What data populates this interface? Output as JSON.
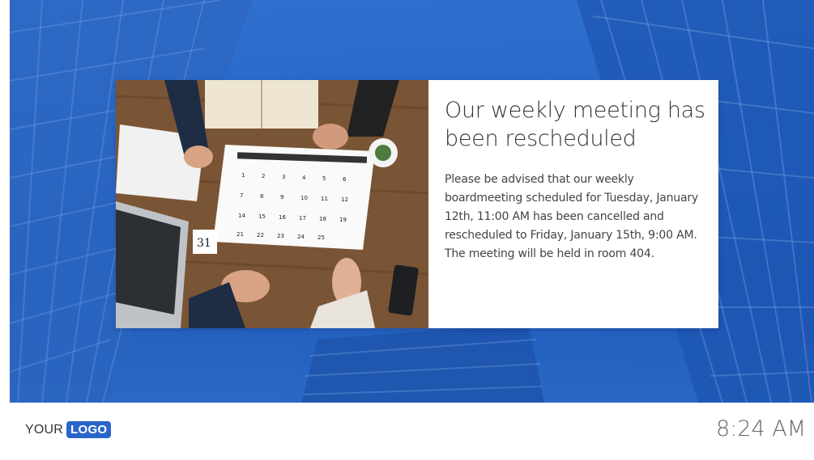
{
  "announcement": {
    "headline": "Our weekly meeting has been rescheduled",
    "body": "Please be advised that our weekly boardmeeting scheduled for Tuesday, January 12th, 11:00 AM has been cancelled and rescheduled to Friday, January 15th, 9:00 AM. The meeting will be held in room 404.",
    "image_icon": "calendar-meeting-photo"
  },
  "footer": {
    "logo_prefix": "YOUR",
    "logo_badge": "LOGO",
    "time": "8:24 AM"
  },
  "colors": {
    "background_blue": "#2565c8",
    "logo_blue": "#2a66c9",
    "card": "#ffffff"
  }
}
